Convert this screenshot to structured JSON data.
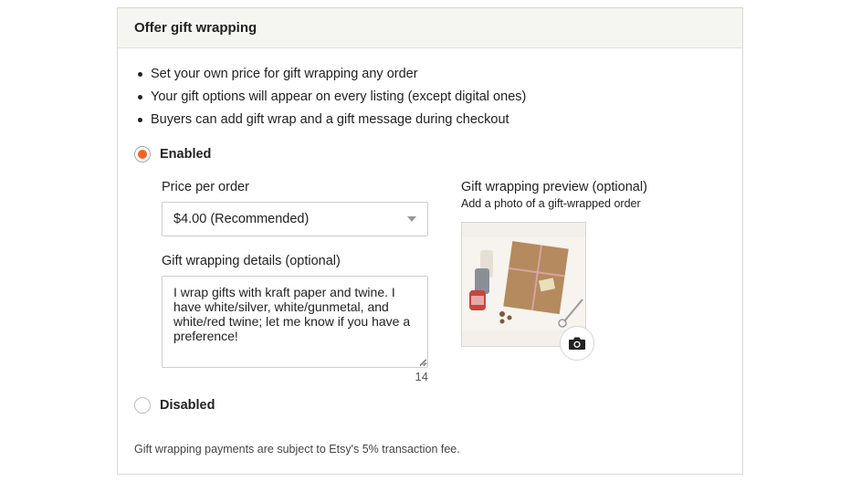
{
  "panel": {
    "title": "Offer gift wrapping"
  },
  "bullets": [
    "Set your own price for gift wrapping any order",
    "Your gift options will appear on every listing (except digital ones)",
    "Buyers can add gift wrap and a gift message during checkout"
  ],
  "options": {
    "enabled_label": "Enabled",
    "disabled_label": "Disabled",
    "selected": "Enabled"
  },
  "price": {
    "label": "Price per order",
    "selected_value": "$4.00 (Recommended)"
  },
  "details": {
    "label": "Gift wrapping details (optional)",
    "value": "I wrap gifts with kraft paper and twine. I have white/silver, white/gunmetal, and white/red twine; let me know if you have a preference!",
    "char_count": "14"
  },
  "preview": {
    "title": "Gift wrapping preview (optional)",
    "subtitle": "Add a photo of a gift-wrapped order",
    "upload_icon": "camera-icon"
  },
  "footnote": "Gift wrapping payments are subject to Etsy's 5% transaction fee.",
  "colors": {
    "accent": "#f1641e",
    "header_bg": "#f5f5f1",
    "border": "#d8d8d8"
  }
}
